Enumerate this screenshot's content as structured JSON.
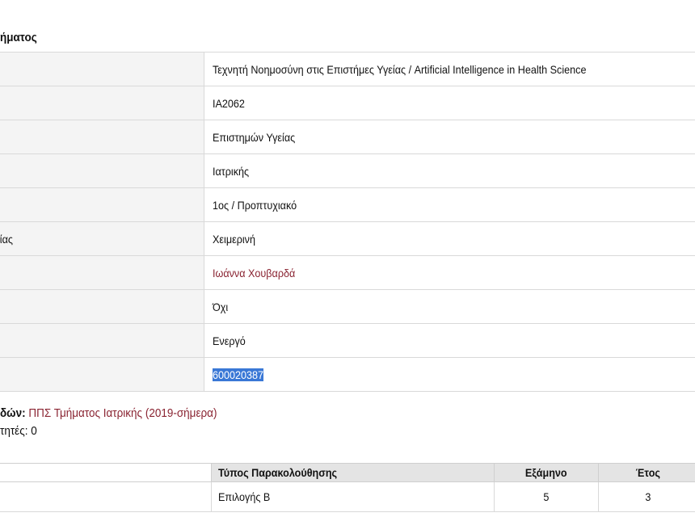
{
  "section_title": "ήματος",
  "info_rows": [
    {
      "label": "",
      "value": "Τεχνητή Νοημοσύνη στις Επιστήμες Υγείας / Artificial Intelligence in Health Science",
      "style": "plain"
    },
    {
      "label": "",
      "value": "IA2062",
      "style": "plain"
    },
    {
      "label": "",
      "value": "Επιστημών Υγείας",
      "style": "plain"
    },
    {
      "label": "",
      "value": "Ιατρικής",
      "style": "plain"
    },
    {
      "label": "",
      "value": "1ος / Προπτυχιακό",
      "style": "plain"
    },
    {
      "label": "ίας",
      "value": "Χειμερινή",
      "style": "plain"
    },
    {
      "label": "",
      "value": "Ιωάννα Χουβαρδά",
      "style": "link"
    },
    {
      "label": "",
      "value": "Όχι",
      "style": "plain"
    },
    {
      "label": "",
      "value": "Ενεργό",
      "style": "plain"
    },
    {
      "label": "",
      "value": "600020387",
      "style": "selected"
    }
  ],
  "program": {
    "label": "δών:",
    "link": "ΠΠΣ Τμήματος Ιατρικής (2019-σήμερα)"
  },
  "students_text": "τητές: 0",
  "program_table": {
    "headers": {
      "first": "",
      "type": "Τύπος Παρακολούθησης",
      "semester": "Εξάμηνο",
      "year": "Έτος"
    },
    "rows": [
      {
        "first": "",
        "type": "Επιλογής Β",
        "semester": "5",
        "year": "3"
      }
    ]
  },
  "colors": {
    "link": "#8a2432",
    "selection": "#3a78d6",
    "label_bg": "#f4f4f4",
    "header_bg": "#e4e4e4"
  }
}
